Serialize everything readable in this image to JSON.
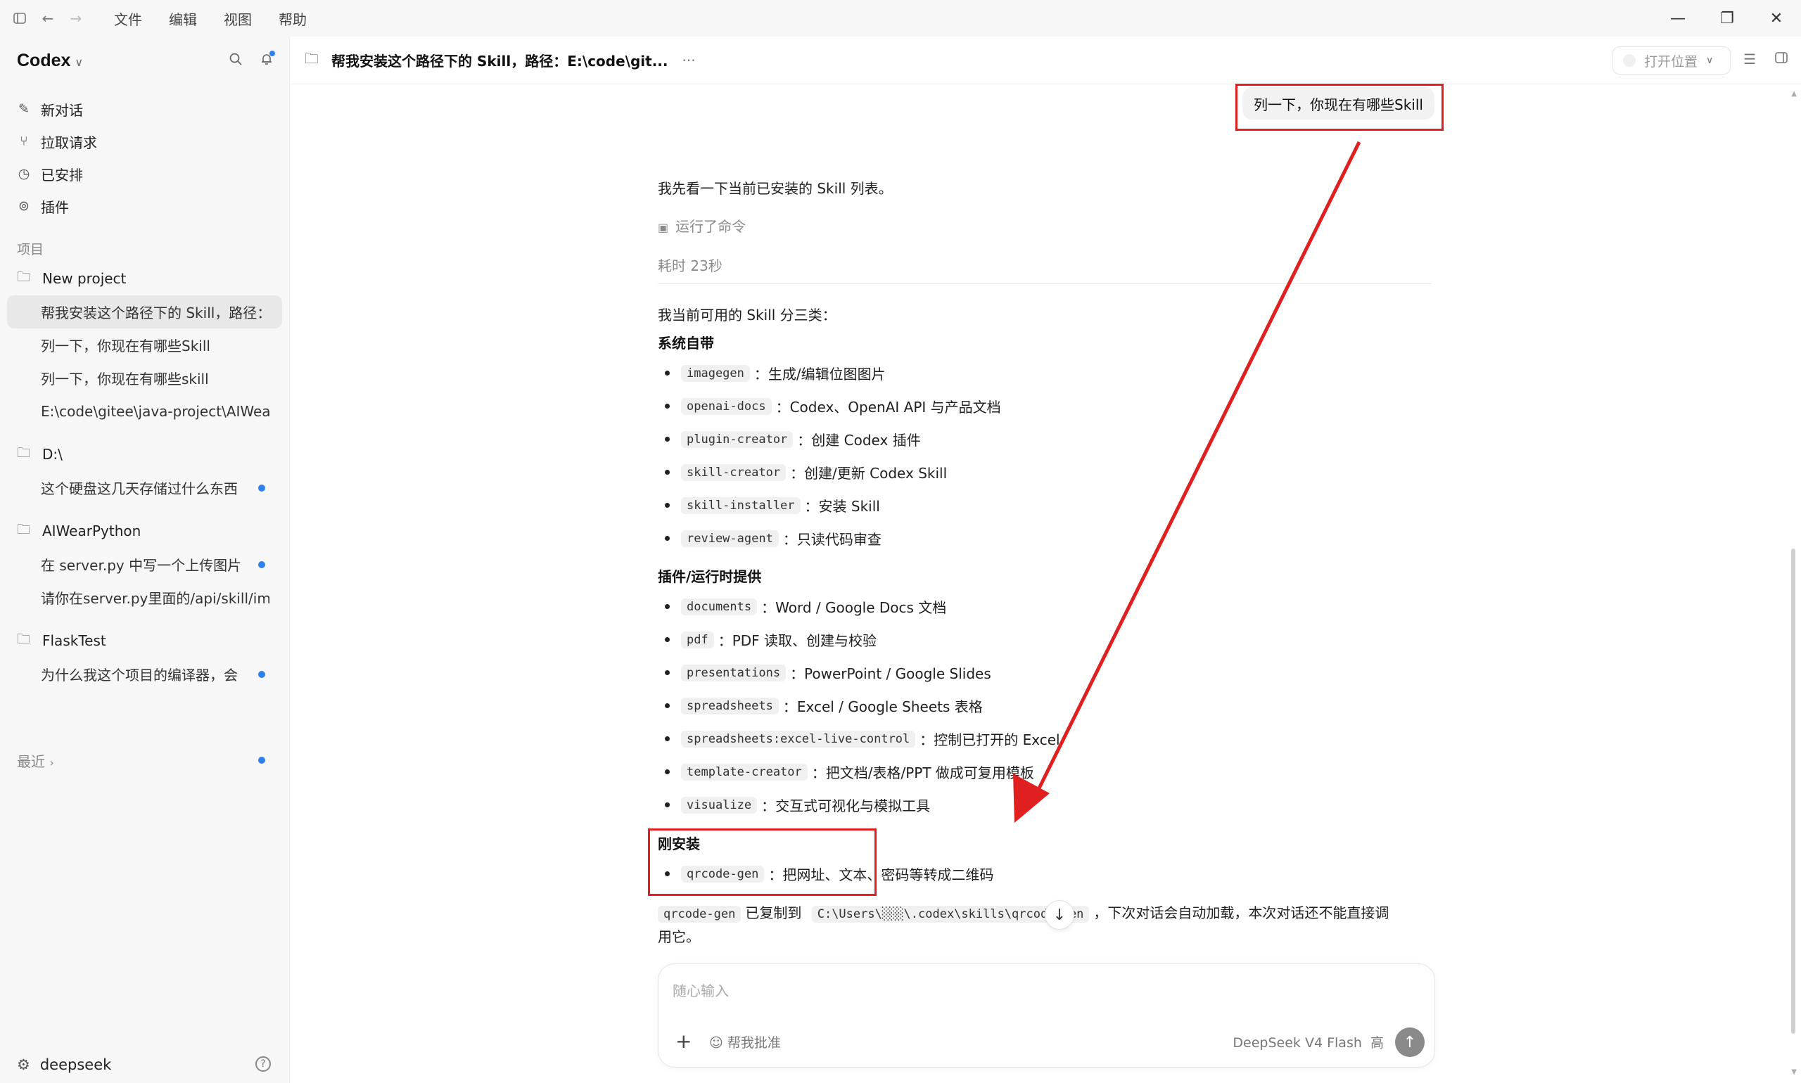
{
  "menu": [
    "文件",
    "编辑",
    "视图",
    "帮助"
  ],
  "sidebar": {
    "brand": "Codex",
    "nav": [
      {
        "icon": "edit-icon",
        "label": "新对话"
      },
      {
        "icon": "pull-request-icon",
        "label": "拉取请求"
      },
      {
        "icon": "clock-icon",
        "label": "已安排"
      },
      {
        "icon": "plugin-icon",
        "label": "插件"
      }
    ],
    "section_label": "项目",
    "projects": [
      {
        "name": "New project",
        "threads": [
          {
            "title": "帮我安装这个路径下的 Skill，路径：E:\\code\\gitee",
            "active": true,
            "unread": false
          },
          {
            "title": "列一下，你现在有哪些Skill",
            "active": false,
            "unread": false
          },
          {
            "title": "列一下，你现在有哪些skill",
            "active": false,
            "unread": false
          },
          {
            "title": "E:\\code\\gitee\\java-project\\AIWear-",
            "active": false,
            "unread": false
          }
        ]
      },
      {
        "name": "D:\\",
        "threads": [
          {
            "title": "这个硬盘这几天存储过什么东西",
            "active": false,
            "unread": true
          }
        ]
      },
      {
        "name": "AIWearPython",
        "threads": [
          {
            "title": "在 server.py 中写一个上传图片的",
            "active": false,
            "unread": true
          },
          {
            "title": "请你在server.py里面的/api/skill/ima",
            "active": false,
            "unread": false
          }
        ]
      },
      {
        "name": "FlaskTest",
        "threads": [
          {
            "title": "为什么我这个项目的编译器，会",
            "active": false,
            "unread": true
          }
        ]
      }
    ],
    "recent": "最近",
    "account": "deepseek"
  },
  "header": {
    "title": "帮我安装这个路径下的 Skill，路径：E:\\code\\git...",
    "more": "···",
    "open_location": "打开位置"
  },
  "conversation": {
    "user_message": "列一下，你现在有哪些Skill",
    "intro": "我先看一下当前已安装的 Skill 列表。",
    "ran_command": "运行了命令",
    "elapsed": "耗时 23秒",
    "summary": "我当前可用的 Skill 分三类：",
    "groups": [
      {
        "title": "系统自带",
        "items": [
          {
            "code": "imagegen",
            "desc": "：生成/编辑位图图片"
          },
          {
            "code": "openai-docs",
            "desc": "：Codex、OpenAI API 与产品文档"
          },
          {
            "code": "plugin-creator",
            "desc": "：创建 Codex 插件"
          },
          {
            "code": "skill-creator",
            "desc": "：创建/更新 Codex Skill"
          },
          {
            "code": "skill-installer",
            "desc": "：安装 Skill"
          },
          {
            "code": "review-agent",
            "desc": "：只读代码审查"
          }
        ]
      },
      {
        "title": "插件/运行时提供",
        "items": [
          {
            "code": "documents",
            "desc": "：Word / Google Docs 文档"
          },
          {
            "code": "pdf",
            "desc": "：PDF 读取、创建与校验"
          },
          {
            "code": "presentations",
            "desc": "：PowerPoint / Google Slides"
          },
          {
            "code": "spreadsheets",
            "desc": "：Excel / Google Sheets 表格"
          },
          {
            "code": "spreadsheets:excel-live-control",
            "desc": "：控制已打开的 Excel"
          },
          {
            "code": "template-creator",
            "desc": "：把文档/表格/PPT 做成可复用模板"
          },
          {
            "code": "visualize",
            "desc": "：交互式可视化与模拟工具"
          }
        ]
      },
      {
        "title": "刚安装",
        "items": [
          {
            "code": "qrcode-gen",
            "desc": "：把网址、文本、密码等转成二维码"
          }
        ]
      }
    ],
    "footer": {
      "code1": "qrcode-gen",
      "text1": "已复制到",
      "code2": "C:\\Users\\░░░\\.codex\\skills\\qrcode-gen",
      "text2": "，下次对话会自动加载，本次对话还不能直接调",
      "text3": "用它。"
    }
  },
  "composer": {
    "placeholder": "随心输入",
    "approve": "帮我批准",
    "model": "DeepSeek V4 Flash",
    "effort": "高"
  },
  "colors": {
    "accent_dot": "#2f80ed",
    "annotation": "#e02020"
  }
}
